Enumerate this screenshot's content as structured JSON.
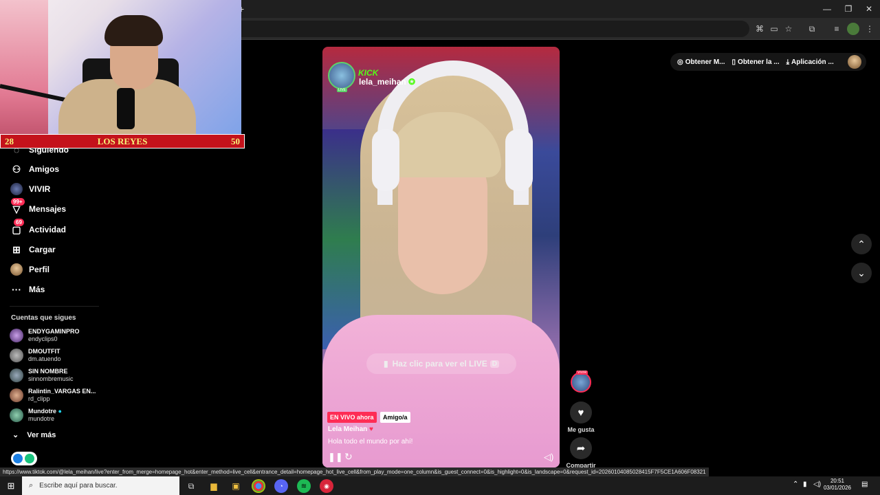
{
  "browser": {
    "window_controls": {
      "minimize": "—",
      "maximize": "❐",
      "close": "✕"
    },
    "new_tab": "+"
  },
  "webcam_overlay": {
    "score_left": "28",
    "score_title": "LOS REYES",
    "score_right": "50"
  },
  "sidebar": {
    "items": [
      {
        "label": "Siguiendo",
        "icon": "following-icon"
      },
      {
        "label": "Amigos",
        "icon": "friends-icon"
      },
      {
        "label": "VIVIR",
        "icon": "live-icon"
      },
      {
        "label": "Mensajes",
        "icon": "messages-icon",
        "badge": "99+"
      },
      {
        "label": "Actividad",
        "icon": "activity-icon",
        "badge": "69"
      },
      {
        "label": "Cargar",
        "icon": "upload-icon"
      },
      {
        "label": "Perfil",
        "icon": "profile-icon"
      },
      {
        "label": "Más",
        "icon": "more-icon"
      }
    ],
    "following_header": "Cuentas que sigues",
    "following": [
      {
        "name": "ENDYGAMINPRO",
        "handle": "endyclips0"
      },
      {
        "name": "DMOUTFIT",
        "handle": "dm.atuendo"
      },
      {
        "name": "SIN NOMBRE",
        "handle": "sinnombremusic"
      },
      {
        "name": "Ralintin_VARGAS EN...",
        "handle": "rd_clipp"
      },
      {
        "name": "Mundotre",
        "handle": "mundotre",
        "verified": true
      }
    ],
    "see_more": "Ver más"
  },
  "top_actions": {
    "get_coins": "Obtener M...",
    "get_app": "Obtener la ...",
    "desktop_app": "Aplicación ..."
  },
  "video": {
    "kick_label": "KICK",
    "channel_name": "lela_meihan",
    "live_tag": "LIVE",
    "click_live": "Haz clic para ver el LIVE",
    "click_live_key": "D",
    "live_badge": "EN VIVO ahora",
    "friend_badge": "Amigo/a",
    "creator": "Lela Meihan",
    "description": "Hola todo el mundo por ahí!"
  },
  "actions": {
    "live_avatar_badge": "VIVIR",
    "like_label": "Me gusta",
    "share_label": "Compartir"
  },
  "status_url": "https://www.tiktok.com/@lela_meihan/live?enter_from_merge=homepage_hot&enter_method=live_cell&entrance_detail=homepage_hot_live_cell&from_play_mode=one_column&is_guest_connect=0&is_highlight=0&is_landscape=0&request_id=20260104085028415F7F5CE1A606F08321",
  "taskbar": {
    "search_placeholder": "Escribe aquí para buscar.",
    "time": "20:51",
    "date": "03/01/2026"
  },
  "colors": {
    "accent": "#fe2c55",
    "kick_green": "#53fc18",
    "score_bg": "#c4121b",
    "score_text": "#f7f47a"
  }
}
